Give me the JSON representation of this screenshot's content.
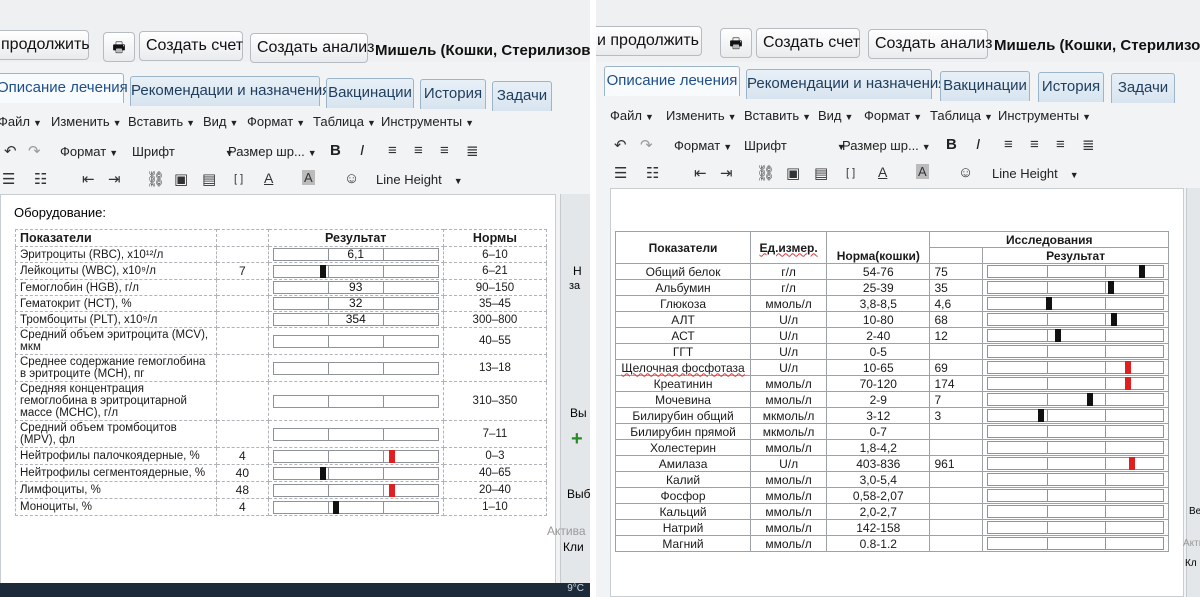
{
  "left_photo": {
    "toolbar_buttons": {
      "continue": "продолжить",
      "create_invoice": "Создать счет",
      "create_analysis": "Создать анализ"
    },
    "patient": "Мишель (Кошки, Стерилизована) До",
    "tabs": [
      "Описание лечения",
      "Рекомендации и назначения",
      "Вакцинации",
      "История",
      "Задачи"
    ],
    "menu": [
      "Файл",
      "Изменить",
      "Вставить",
      "Вид",
      "Формат",
      "Таблица",
      "Инструменты"
    ],
    "format_row": {
      "format": "Формат",
      "font": "Шрифт",
      "size": "Размер шр...",
      "bold": "B",
      "italic": "I"
    },
    "line_height": "Line Height",
    "section_title": "Оборудование:",
    "headers": {
      "param": "Показатели",
      "result": "Результат",
      "norm": "Нормы"
    },
    "rows": [
      {
        "name": "Эритроциты (RBC), x10¹²/л",
        "value": "",
        "bar_value": "6,1",
        "marker": null,
        "norm": "6–10"
      },
      {
        "name": "Лейкоциты (WBC), x10⁹/л",
        "value": "7",
        "bar_value": "",
        "marker": 0.3,
        "marker_color": "#111111",
        "norm": "6–21"
      },
      {
        "name": "Гемоглобин (HGB), г/л",
        "value": "",
        "bar_value": "93",
        "marker": null,
        "norm": "90–150"
      },
      {
        "name": "Гематокрит (HCT), %",
        "value": "",
        "bar_value": "32",
        "marker": null,
        "norm": "35–45"
      },
      {
        "name": "Тромбоциты (PLT), x10⁹/л",
        "value": "",
        "bar_value": "354",
        "marker": null,
        "norm": "300–800"
      },
      {
        "name": "Средний объем эритроцита (MCV), мкм",
        "value": "",
        "bar_value": "",
        "marker": null,
        "norm": "40–55"
      },
      {
        "name": "Среднее содержание гемоглобина в эритроците (MCH), пг",
        "value": "",
        "bar_value": "",
        "marker": null,
        "norm": "13–18"
      },
      {
        "name": "Средняя концентрация гемоглобина в эритроцитарной массе (MCHC), г/л",
        "value": "",
        "bar_value": "",
        "marker": null,
        "norm": "310–350"
      },
      {
        "name": "Средний объем тромбоцитов (MPV), фл",
        "value": "",
        "bar_value": "",
        "marker": null,
        "norm": "7–11"
      },
      {
        "name": "Нейтрофилы палочкоядерные, %",
        "value": "4",
        "bar_value": "",
        "marker": 0.72,
        "marker_color": "#e02020",
        "norm": "0–3"
      },
      {
        "name": "Нейтрофилы сегментоядерные, %",
        "value": "40",
        "bar_value": "",
        "marker": 0.3,
        "marker_color": "#111111",
        "norm": "40–65"
      },
      {
        "name": "Лимфоциты, %",
        "value": "48",
        "bar_value": "",
        "marker": 0.72,
        "marker_color": "#e02020",
        "norm": "20–40"
      },
      {
        "name": "Моноциты, %",
        "value": "4",
        "bar_value": "",
        "marker": 0.38,
        "marker_color": "#111111",
        "norm": "1–10"
      }
    ],
    "side_labels": [
      "Н",
      "за",
      "Вы",
      "Выб",
      "Актива",
      "Кли",
      "9°С"
    ]
  },
  "right_photo": {
    "toolbar_buttons": {
      "continue": "и продолжить",
      "create_invoice": "Создать счет",
      "create_analysis": "Создать анализ"
    },
    "patient": "Мишель (Кошки, Стерилизована) Д",
    "tabs": [
      "Описание лечения",
      "Рекомендации и назначения",
      "Вакцинации",
      "История",
      "Задачи"
    ],
    "menu": [
      "Файл",
      "Изменить",
      "Вставить",
      "Вид",
      "Формат",
      "Таблица",
      "Инструменты"
    ],
    "format_row": {
      "format": "Формат",
      "font": "Шрифт",
      "size": "Размер шр...",
      "bold": "B",
      "italic": "I"
    },
    "line_height": "Line Height",
    "headers": {
      "param": "Показатели",
      "unit": "Ед.измер.",
      "norm": "Норма(кошки)",
      "study": "Исследования",
      "result": "Результат"
    },
    "rows": [
      {
        "name": "Общий белок",
        "unit": "г/л",
        "norm": "54-76",
        "value": "75",
        "marker": 0.88,
        "marker_color": "#111111"
      },
      {
        "name": "Альбумин",
        "unit": "г/л",
        "norm": "25-39",
        "value": "35",
        "marker": 0.7,
        "marker_color": "#111111"
      },
      {
        "name": "Глюкоза",
        "unit": "ммоль/л",
        "norm": "3,8-8,5",
        "value": "4,6",
        "marker": 0.35,
        "marker_color": "#111111"
      },
      {
        "name": "АЛТ",
        "unit": "U/л",
        "norm": "10-80",
        "value": "68",
        "marker": 0.72,
        "marker_color": "#111111"
      },
      {
        "name": "АСТ",
        "unit": "U/л",
        "norm": "2-40",
        "value": "12",
        "marker": 0.4,
        "marker_color": "#111111"
      },
      {
        "name": "ГГТ",
        "unit": "U/л",
        "norm": "0-5",
        "value": "",
        "marker": null
      },
      {
        "name": "Щелочная фосфотаза",
        "unit": "U/л",
        "norm": "10-65",
        "value": "69",
        "marker": 0.8,
        "marker_color": "#e02020"
      },
      {
        "name": "Креатинин",
        "unit": "ммоль/л",
        "norm": "70-120",
        "value": "174",
        "marker": 0.8,
        "marker_color": "#e02020"
      },
      {
        "name": "Мочевина",
        "unit": "ммоль/л",
        "norm": "2-9",
        "value": "7",
        "marker": 0.58,
        "marker_color": "#111111"
      },
      {
        "name": "Билирубин общий",
        "unit": "мкмоль/л",
        "norm": "3-12",
        "value": "3",
        "marker": 0.3,
        "marker_color": "#111111"
      },
      {
        "name": "Билирубин прямой",
        "unit": "мкмоль/л",
        "norm": "0-7",
        "value": "",
        "marker": null
      },
      {
        "name": "Холестерин",
        "unit": "ммоль/л",
        "norm": "1,8-4,2",
        "value": "",
        "marker": null
      },
      {
        "name": "Амилаза",
        "unit": "U/л",
        "norm": "403-836",
        "value": "961",
        "marker": 0.82,
        "marker_color": "#e02020"
      },
      {
        "name": "Калий",
        "unit": "ммоль/л",
        "norm": "3,0-5,4",
        "value": "",
        "marker": null
      },
      {
        "name": "Фосфор",
        "unit": "ммоль/л",
        "norm": "0,58-2,07",
        "value": "",
        "marker": null
      },
      {
        "name": "Кальций",
        "unit": "ммоль/л",
        "norm": "2,0-2,7",
        "value": "",
        "marker": null
      },
      {
        "name": "Натрий",
        "unit": "ммоль/л",
        "norm": "142-158",
        "value": "",
        "marker": null
      },
      {
        "name": "Магний",
        "unit": "ммоль/л",
        "norm": "0.8-1.2",
        "value": "",
        "marker": null
      }
    ],
    "side_labels": [
      "Ве",
      "Акти",
      "Кл"
    ]
  }
}
